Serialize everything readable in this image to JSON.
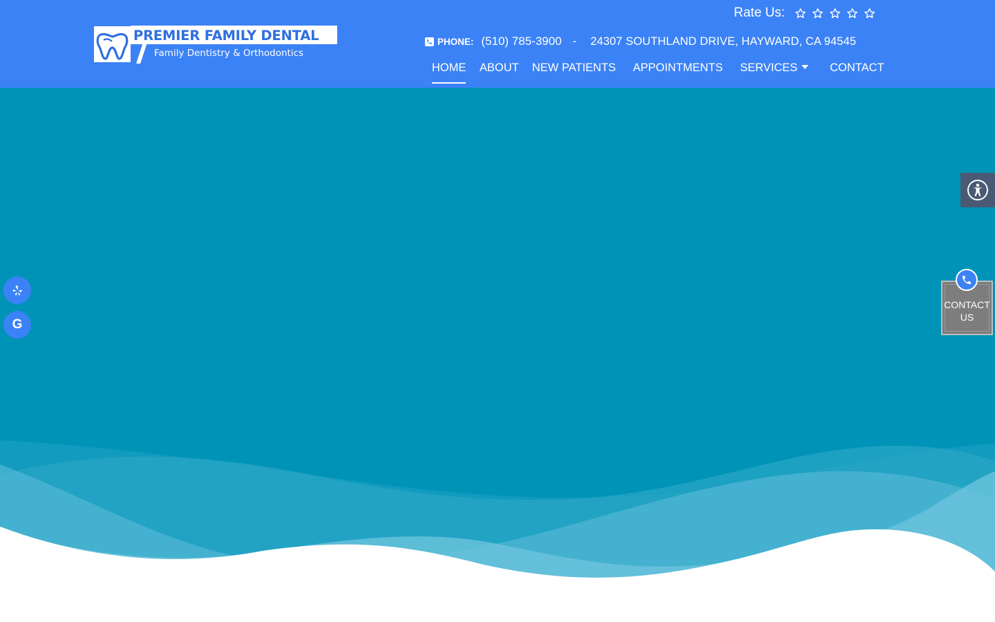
{
  "brand": {
    "name": "PREMIER FAMILY DENTAL",
    "tagline": "Family Dentistry & Orthodontics",
    "primary_color": "#3b82f6",
    "hero_color": "#0093b8"
  },
  "rating": {
    "label": "Rate Us:",
    "stars": 5,
    "icon": "star-outline-icon"
  },
  "contact_bar": {
    "phone_label": "PHONE:",
    "phone": "(510) 785-3900",
    "separator": "-",
    "address": "24307 SOUTHLAND DRIVE, HAYWARD, CA 94545"
  },
  "nav": {
    "items": [
      {
        "label": "HOME",
        "active": true
      },
      {
        "label": "ABOUT"
      },
      {
        "label": "NEW PATIENTS"
      },
      {
        "label": "APPOINTMENTS"
      },
      {
        "label": "SERVICES",
        "has_dropdown": true
      },
      {
        "label": "CONTACT"
      }
    ]
  },
  "widgets": {
    "accessibility_icon": "accessibility-icon",
    "social": [
      "yelp-icon",
      "google-icon"
    ],
    "google_letter": "G",
    "contact_us": {
      "line1": "CONTACT",
      "line2": "US",
      "icon": "phone-icon"
    }
  }
}
